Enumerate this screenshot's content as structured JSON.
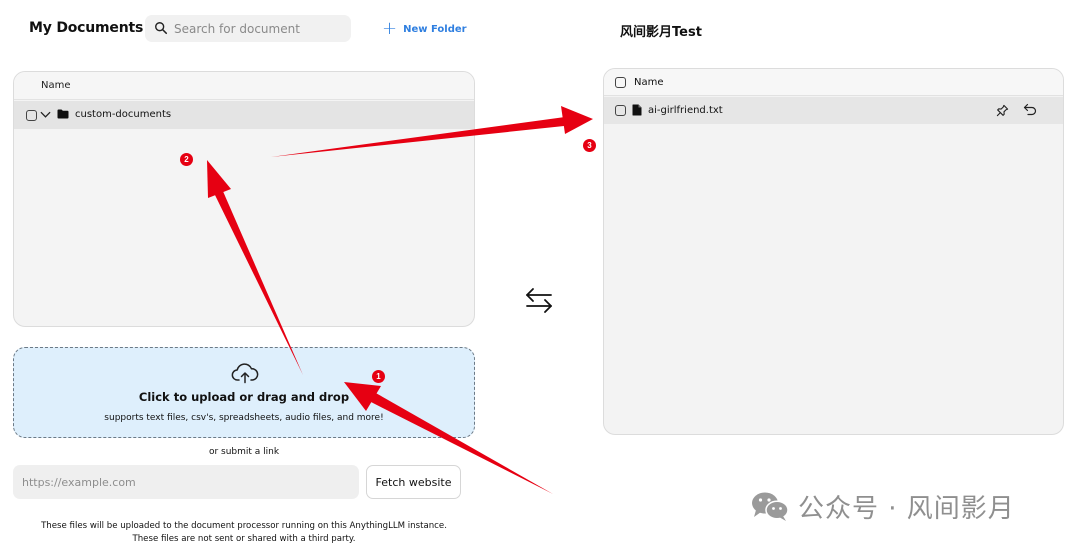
{
  "left": {
    "title": "My Documents",
    "search_placeholder": "Search for document",
    "new_folder_label": "New Folder",
    "table_header": "Name",
    "folder": {
      "name": "custom-documents"
    }
  },
  "upload": {
    "title": "Click to upload or drag and drop",
    "subtitle": "supports text files, csv's, spreadsheets, audio files, and more!",
    "or_link": "or submit a link",
    "url_placeholder": "https://example.com",
    "fetch_label": "Fetch website",
    "disclaimer_line1": "These files will be uploaded to the document processor running on this AnythingLLM instance.",
    "disclaimer_line2": "These files are not sent or shared with a third party."
  },
  "right": {
    "title": "风间影月Test",
    "table_header": "Name",
    "file": {
      "name": "ai-girlfriend.txt"
    }
  },
  "annotations": {
    "badges": [
      "1",
      "2",
      "3"
    ],
    "color": "#e60012"
  },
  "watermark": {
    "text": "公众号 · 风间影月"
  },
  "icons": {
    "search": "search-icon",
    "plus": "plus-icon",
    "checkbox": "checkbox-icon",
    "chevron": "chevron-down-icon",
    "folder": "folder-icon",
    "file": "file-icon",
    "pin": "pin-icon",
    "undo": "undo-icon",
    "upload": "cloud-upload-icon",
    "swap": "swap-arrows-icon",
    "wechat": "wechat-icon"
  },
  "colors": {
    "accent": "#2f7fe0",
    "dropzone_bg": "#deeffc",
    "arrow": "#e60012"
  }
}
